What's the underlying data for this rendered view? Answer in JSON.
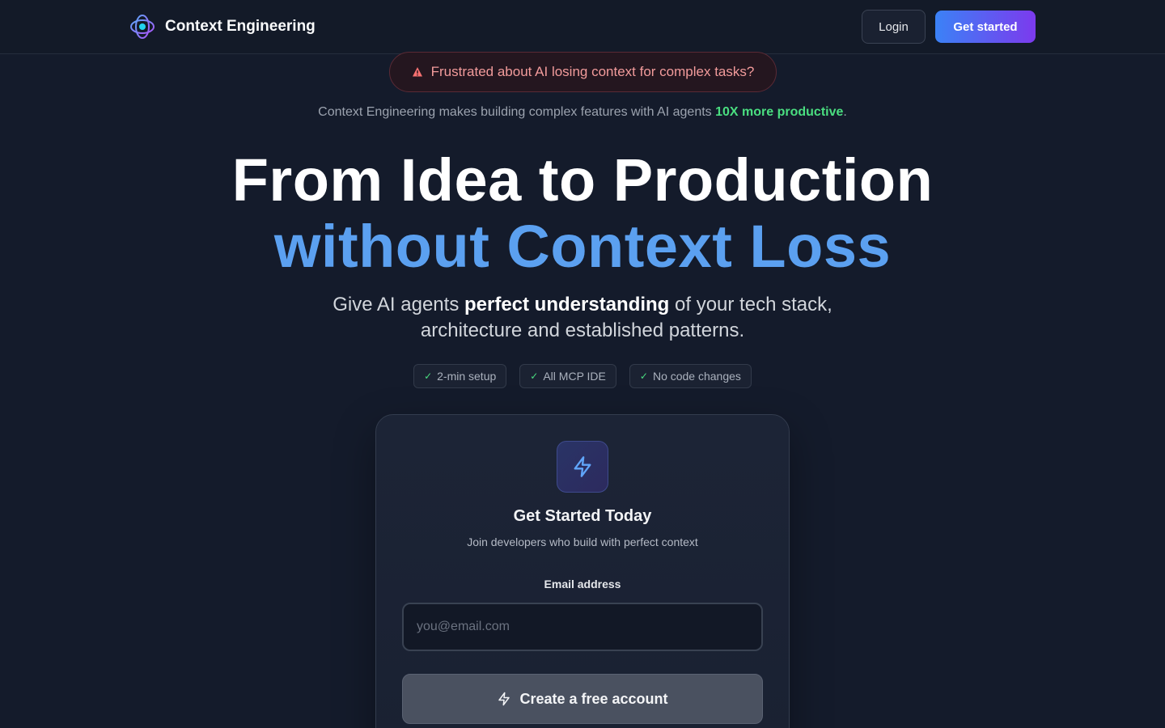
{
  "header": {
    "brand_name": "Context Engineering",
    "login_label": "Login",
    "get_started_label": "Get started"
  },
  "alert": {
    "icon": "warning-triangle-icon",
    "text": "Frustrated about AI losing context for complex tasks?"
  },
  "tagline": {
    "prefix": "Context Engineering makes building complex features with AI agents ",
    "highlight": "10X more productive",
    "suffix": "."
  },
  "hero": {
    "line1": "From Idea to Production",
    "line2": "without Context Loss",
    "subtitle_prefix": "Give AI agents ",
    "subtitle_bold": "perfect understanding",
    "subtitle_rest": " of your tech stack,",
    "subtitle_line2": "architecture and established patterns."
  },
  "chips": [
    {
      "check": "✓",
      "label": "2-min setup"
    },
    {
      "check": "✓",
      "label": "All MCP IDE"
    },
    {
      "check": "✓",
      "label": "No code changes"
    }
  ],
  "signup_card": {
    "icon": "lightning-bolt-icon",
    "title": "Get Started Today",
    "subtitle": "Join developers who build with perfect context",
    "email_label": "Email address",
    "email_value": "",
    "email_placeholder": "you@email.com",
    "submit_label": "Create a free account"
  },
  "colors": {
    "background": "#141b2b",
    "accent_blue": "#5ba0f0",
    "accent_green": "#4ade80",
    "alert_red": "#f29b9b",
    "cta_gradient_start": "#3b82f6",
    "cta_gradient_end": "#7c3aed"
  }
}
